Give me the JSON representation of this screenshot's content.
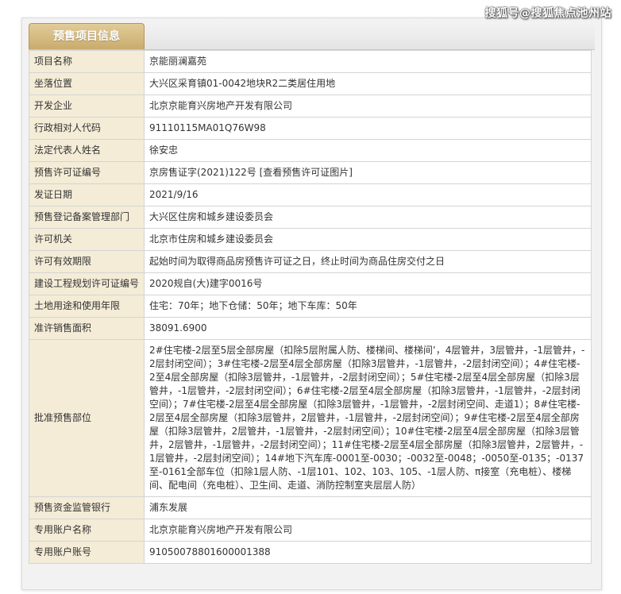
{
  "watermark": "搜狐号@搜狐焦点池州站",
  "panel": {
    "tab_title": "预售项目信息"
  },
  "rows": [
    {
      "label": "项目名称",
      "value": "京能丽澜嘉苑"
    },
    {
      "label": "坐落位置",
      "value": "大兴区采育镇01-0042地块R2二类居住用地"
    },
    {
      "label": "开发企业",
      "value": "北京京能育兴房地产开发有限公司"
    },
    {
      "label": "行政相对人代码",
      "value": "91110115MA01Q76W98"
    },
    {
      "label": "法定代表人姓名",
      "value": "徐安忠"
    },
    {
      "label": "预售许可证编号",
      "value": "京房售证字(2021)122号 [查看预售许可证图片]"
    },
    {
      "label": "发证日期",
      "value": "2021/9/16"
    },
    {
      "label": "预售登记备案管理部门",
      "value": "大兴区住房和城乡建设委员会"
    },
    {
      "label": "许可机关",
      "value": "北京市住房和城乡建设委员会"
    },
    {
      "label": "许可有效期限",
      "value": "起始时间为取得商品房预售许可证之日，终止时间为商品住房交付之日"
    },
    {
      "label": "建设工程规划许可证编号",
      "value": "2020规自(大)建字0016号"
    },
    {
      "label": "土地用途和使用年限",
      "value": "住宅：70年；地下仓储：50年；地下车库：50年"
    },
    {
      "label": "准许销售面积",
      "value": "38091.6900"
    },
    {
      "label": "批准预售部位",
      "value": "2#住宅楼-2层至5层全部房屋（扣除5层附属人防、楼梯间、楼梯间’，4层管井，3层管井，-1层管井，-2层封闭空间）；3#住宅楼-2层至4层全部房屋（扣除3层管井，-1层管井，-2层封闭空间）；4#住宅楼-2至4层全部房屋（扣除3层管井，-1层管井，-2层封闭空间）；5#住宅楼-2层至4层全部房屋（扣除3层管井，-1层管井，-2层封闭空间）；6#住宅楼-2层至4层全部房屋（扣除3层管井，-1层管井，-2层封闭空间）；7#住宅楼-2层至4层全部房屋（扣除3层管井，-1层管井，-2层封闭空间、走道1）；8#住宅楼-2层至4层全部房屋（扣除3层管井，2层管井，-1层管井，-2层封闭空间）；9#住宅楼-2层至4层全部房屋（扣除3层管井，2层管井，-1层管井，-2层封闭空间）；10#住宅楼-2层至4层全部房屋（扣除3层管井，2层管井，-1层管井，-2层封闭空间）；11#住宅楼-2层至4层全部房屋（扣除3层管井，2层管井，-1层管井，-2层封闭空间）；14#地下汽车库-0001至-0030；-0032至-0048；-0050至-0135；-0137至-0161全部车位（扣除1层人防、-1层101、102、103、105、-1层人防、π接室（充电桩）、楼梯间、配电间（充电桩）、卫生间、走道、消防控制室夹层层人防）"
    },
    {
      "label": "预售资金监管银行",
      "value": "浦东发展"
    },
    {
      "label": "专用账户名称",
      "value": "北京京能育兴房地产开发有限公司"
    },
    {
      "label": "专用账户账号",
      "value": "91050078801600001388"
    }
  ]
}
